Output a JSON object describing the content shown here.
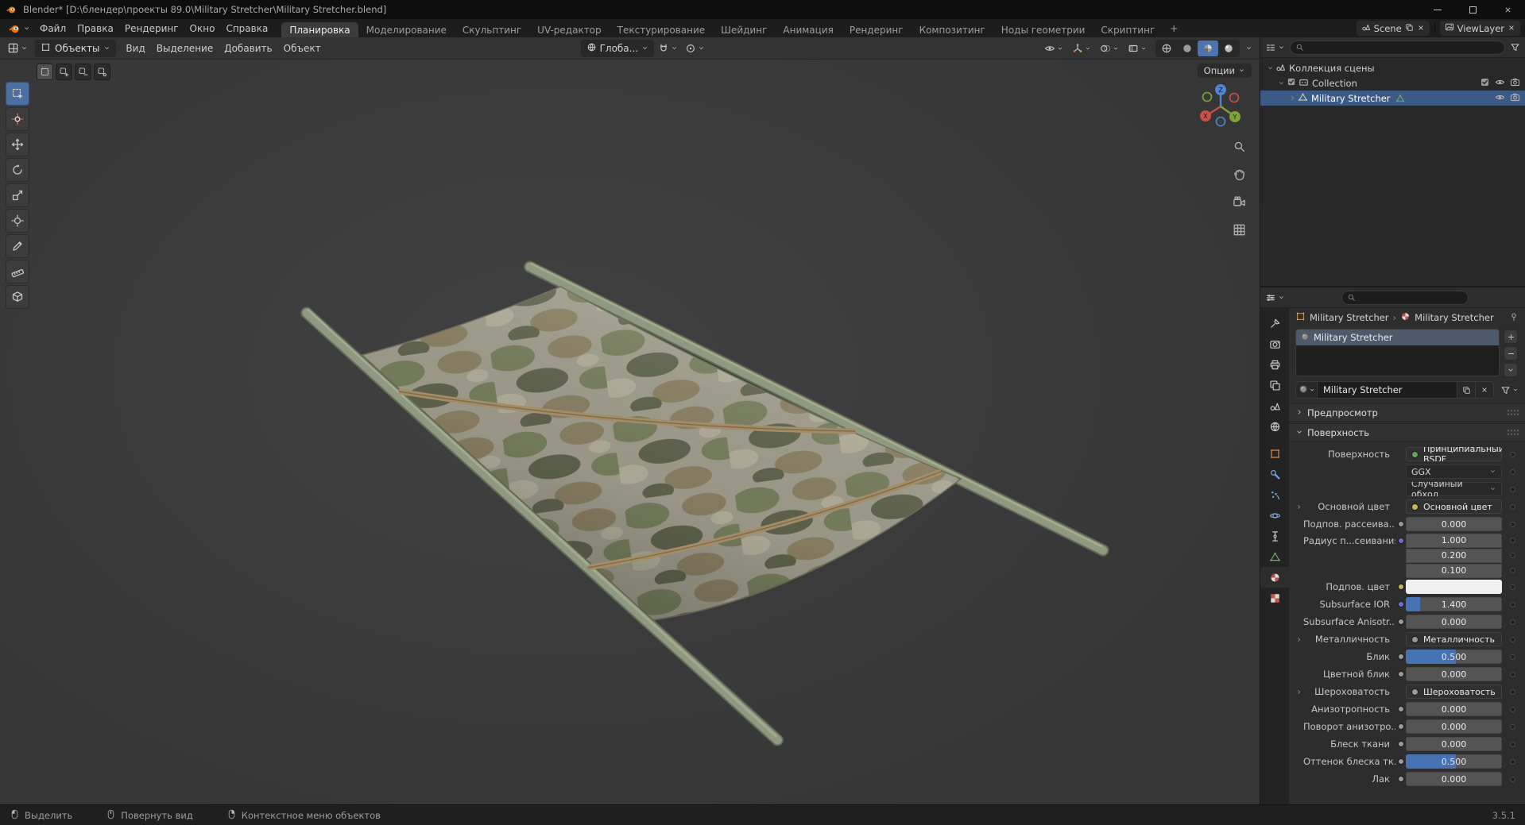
{
  "window": {
    "title": "Blender* [D:\\блендер\\проекты 89.0\\Military Stretcher\\Military Stretcher.blend]"
  },
  "topbar": {
    "menus": [
      "Файл",
      "Правка",
      "Рендеринг",
      "Окно",
      "Справка"
    ],
    "tabs": [
      "Планировка",
      "Моделирование",
      "Скульптинг",
      "UV-редактор",
      "Текстурирование",
      "Шейдинг",
      "Анимация",
      "Рендеринг",
      "Композитинг",
      "Ноды геометрии",
      "Скриптинг"
    ],
    "active_tab": "Планировка",
    "add_tab": "+",
    "scene_label": "Scene",
    "viewlayer_label": "ViewLayer"
  },
  "viewport": {
    "mode": "Объекты",
    "menus": [
      "Вид",
      "Выделение",
      "Добавить",
      "Объект"
    ],
    "orientation": "Глоба...",
    "options_label": "Опции",
    "toolbar": [
      "box-select",
      "cursor-3d",
      "move",
      "rotate",
      "scale",
      "transform",
      "annotate",
      "measure",
      "add-cube"
    ],
    "active_tool": "box-select",
    "nav_icons": [
      "zoom",
      "pan",
      "camera-view",
      "grid-view"
    ],
    "header_right_icons": [
      "eye",
      "gizmo-axes",
      "overlays",
      "xray"
    ],
    "shading_modes": [
      "shading-wireframe",
      "shading-solid",
      "shading-material",
      "shading-rendered"
    ],
    "shading_active": "shading-material",
    "gizmo_axes": [
      "X",
      "Y",
      "Z"
    ]
  },
  "outliner": {
    "rows": [
      {
        "key": "scene-collection",
        "label": "Коллекция сцены",
        "icon": "scene",
        "indent": 0,
        "disclosure": "open",
        "selected": false,
        "checkbox": false,
        "right": []
      },
      {
        "key": "collection",
        "label": "Collection",
        "icon": "collection",
        "indent": 1,
        "disclosure": "open",
        "selected": false,
        "checkbox": true,
        "right": [
          "checkbox",
          "eye",
          "camera-photo"
        ]
      },
      {
        "key": "military-stretcher",
        "label": "Military Stretcher",
        "icon": "mesh-object",
        "indent": 2,
        "disclosure": "closed",
        "selected": true,
        "checkbox": false,
        "extra": "mesh-data",
        "right": [
          "eye",
          "camera-photo"
        ]
      }
    ]
  },
  "properties": {
    "tabs": [
      {
        "name": "tool",
        "active": false
      },
      {
        "name": "render",
        "active": false
      },
      {
        "name": "output",
        "active": false
      },
      {
        "name": "view-layer",
        "active": false
      },
      {
        "name": "scene",
        "active": false
      },
      {
        "name": "world",
        "active": false
      },
      {
        "name": "object",
        "active": false,
        "gap": true
      },
      {
        "name": "modifiers",
        "active": false
      },
      {
        "name": "particles",
        "active": false
      },
      {
        "name": "physics",
        "active": false
      },
      {
        "name": "constraints",
        "active": false
      },
      {
        "name": "object-data",
        "active": false
      },
      {
        "name": "material",
        "active": true
      },
      {
        "name": "texture",
        "active": false
      }
    ],
    "breadcrumb_object": "Military Stretcher",
    "breadcrumb_material": "Military Stretcher",
    "slot_name": "Military Stretcher",
    "material_name": "Military Stretcher",
    "panel_preview": "Предпросмотр",
    "panel_surface": "Поверхность",
    "surface_rows": [
      {
        "key": "surface",
        "label": "Поверхность",
        "widget": "node",
        "value": "Принципиальный BSDF",
        "dot": "#63a25f"
      },
      {
        "key": "distribution",
        "label": "",
        "widget": "menu",
        "value": "GGX"
      },
      {
        "key": "subsurface-method",
        "label": "",
        "widget": "menu",
        "value": "Случайный обход"
      },
      {
        "key": "base-color",
        "label": "Основной цвет",
        "widget": "node",
        "value": "Основной цвет",
        "dot": "#c8b64e",
        "expand": true
      },
      {
        "key": "subsurface",
        "label": "Подпов. рассеива...",
        "widget": "slider",
        "value": "0.000",
        "fill": 0,
        "socket": "#9a9a9a"
      },
      {
        "key": "subsurface-radius-r",
        "label": "Радиус п...сеивания",
        "widget": "number",
        "value": "1.000",
        "socket": "#7070cf",
        "group": "top"
      },
      {
        "key": "subsurface-radius-g",
        "label": "",
        "widget": "number",
        "value": "0.200",
        "group": "mid"
      },
      {
        "key": "subsurface-radius-b",
        "label": "",
        "widget": "number",
        "value": "0.100",
        "group": "bot"
      },
      {
        "key": "subsurface-color",
        "label": "Подпов. цвет",
        "widget": "color",
        "value": "",
        "color": "#efefef",
        "socket": "#c8b64e"
      },
      {
        "key": "subsurface-ior",
        "label": "Subsurface IOR",
        "widget": "slider",
        "value": "1.400",
        "fill": 0.15,
        "socket": "#7070cf"
      },
      {
        "key": "subsurface-anisotropy",
        "label": "Subsurface Anisotr...",
        "widget": "slider",
        "value": "0.000",
        "fill": 0,
        "socket": "#9a9a9a"
      },
      {
        "key": "metallic",
        "label": "Металличность",
        "widget": "node",
        "value": "Металличность",
        "dot": "#9a9a9a",
        "expand": true
      },
      {
        "key": "specular",
        "label": "Блик",
        "widget": "slider",
        "value": "0.500",
        "fill": 0.52,
        "socket": "#9a9a9a"
      },
      {
        "key": "specular-tint",
        "label": "Цветной блик",
        "widget": "slider",
        "value": "0.000",
        "fill": 0,
        "socket": "#9a9a9a"
      },
      {
        "key": "roughness",
        "label": "Шероховатость",
        "widget": "node",
        "value": "Шероховатость",
        "dot": "#9a9a9a",
        "expand": true
      },
      {
        "key": "anisotropic",
        "label": "Анизотропность",
        "widget": "slider",
        "value": "0.000",
        "fill": 0,
        "socket": "#9a9a9a"
      },
      {
        "key": "anisotropic-rotation",
        "label": "Поворот анизотро...",
        "widget": "slider",
        "value": "0.000",
        "fill": 0,
        "socket": "#9a9a9a"
      },
      {
        "key": "sheen",
        "label": "Блеск ткани",
        "widget": "slider",
        "value": "0.000",
        "fill": 0,
        "socket": "#9a9a9a"
      },
      {
        "key": "sheen-tint",
        "label": "Оттенок блеска тк...",
        "widget": "slider",
        "value": "0.500",
        "fill": 0.52,
        "socket": "#9a9a9a"
      },
      {
        "key": "clearcoat",
        "label": "Лак",
        "widget": "slider",
        "value": "0.000",
        "fill": 0,
        "socket": "#9a9a9a"
      }
    ]
  },
  "statusbar": {
    "items": [
      {
        "label": "Выделить",
        "mouse": "mouse-left"
      },
      {
        "label": "Повернуть вид",
        "mouse": "mouse-middle"
      },
      {
        "label": "Контекстное меню объектов",
        "mouse": "mouse-right"
      }
    ],
    "version": "3.5.1"
  },
  "colors": {
    "accent": "#4772b3",
    "selection": "#3b5a86",
    "axis_x": "#c94f49",
    "axis_y": "#7ea33c",
    "axis_z": "#4e86cf"
  }
}
